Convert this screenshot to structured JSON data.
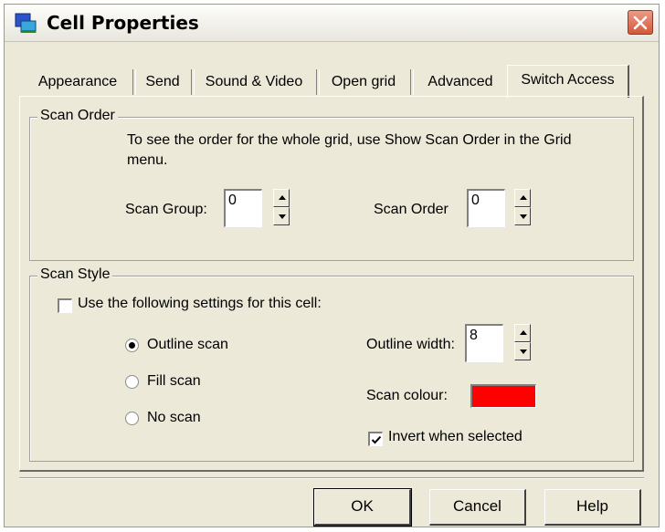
{
  "window": {
    "title": "Cell Properties"
  },
  "tabs": [
    {
      "label": "Appearance"
    },
    {
      "label": "Send"
    },
    {
      "label": "Sound & Video"
    },
    {
      "label": "Open grid"
    },
    {
      "label": "Advanced"
    },
    {
      "label": "Switch Access",
      "active": true
    }
  ],
  "scan_order": {
    "group_title": "Scan Order",
    "info_line1": "To see the order for the whole grid, use Show Scan Order in the Grid",
    "info_line2": "menu.",
    "scan_group_label": "Scan Group:",
    "scan_group_value": "0",
    "scan_order_label": "Scan Order",
    "scan_order_value": "0"
  },
  "scan_style": {
    "group_title": "Scan Style",
    "use_settings_label": "Use the following settings for this cell:",
    "use_settings_checked": false,
    "radio_options": [
      {
        "label": "Outline scan",
        "selected": true
      },
      {
        "label": "Fill scan",
        "selected": false
      },
      {
        "label": "No scan",
        "selected": false
      }
    ],
    "outline_width_label": "Outline width:",
    "outline_width_value": "8",
    "scan_colour_label": "Scan colour:",
    "scan_colour": "#ff0000",
    "invert_label": "Invert when selected",
    "invert_checked": true
  },
  "buttons": {
    "ok": "OK",
    "cancel": "Cancel",
    "help": "Help"
  }
}
